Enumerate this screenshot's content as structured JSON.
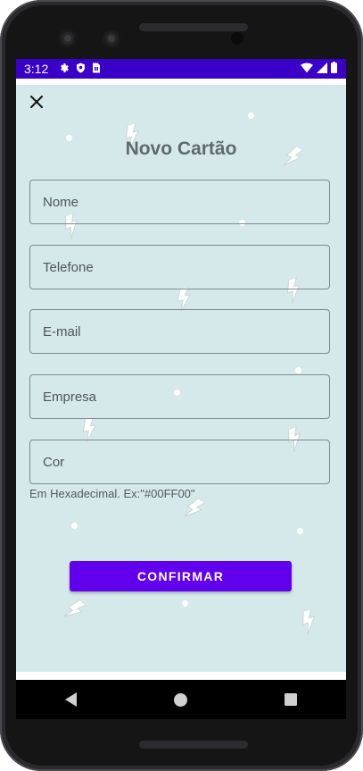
{
  "status_bar": {
    "time": "3:12",
    "background": "#3a00c8",
    "left_icons": [
      "settings-icon",
      "shield-icon",
      "sim-card-icon"
    ],
    "right_icons": [
      "wifi-icon",
      "signal-icon",
      "battery-icon"
    ]
  },
  "form": {
    "title": "Novo Cartão",
    "fields": [
      {
        "name": "nome",
        "placeholder": "Nome",
        "value": ""
      },
      {
        "name": "telefone",
        "placeholder": "Telefone",
        "value": ""
      },
      {
        "name": "email",
        "placeholder": "E-mail",
        "value": ""
      },
      {
        "name": "empresa",
        "placeholder": "Empresa",
        "value": ""
      },
      {
        "name": "cor",
        "placeholder": "Cor",
        "value": ""
      }
    ],
    "cor_helper": "Em Hexadecimal. Ex:\"#00FF00\"",
    "confirm_label": "CONFIRMAR",
    "close_icon": "close-icon"
  },
  "colors": {
    "accent": "#6200ee",
    "background": "#d6e9ea",
    "title": "#5e6a6d"
  },
  "nav_bar": {
    "buttons": [
      "back-icon",
      "home-icon",
      "recents-icon"
    ]
  }
}
